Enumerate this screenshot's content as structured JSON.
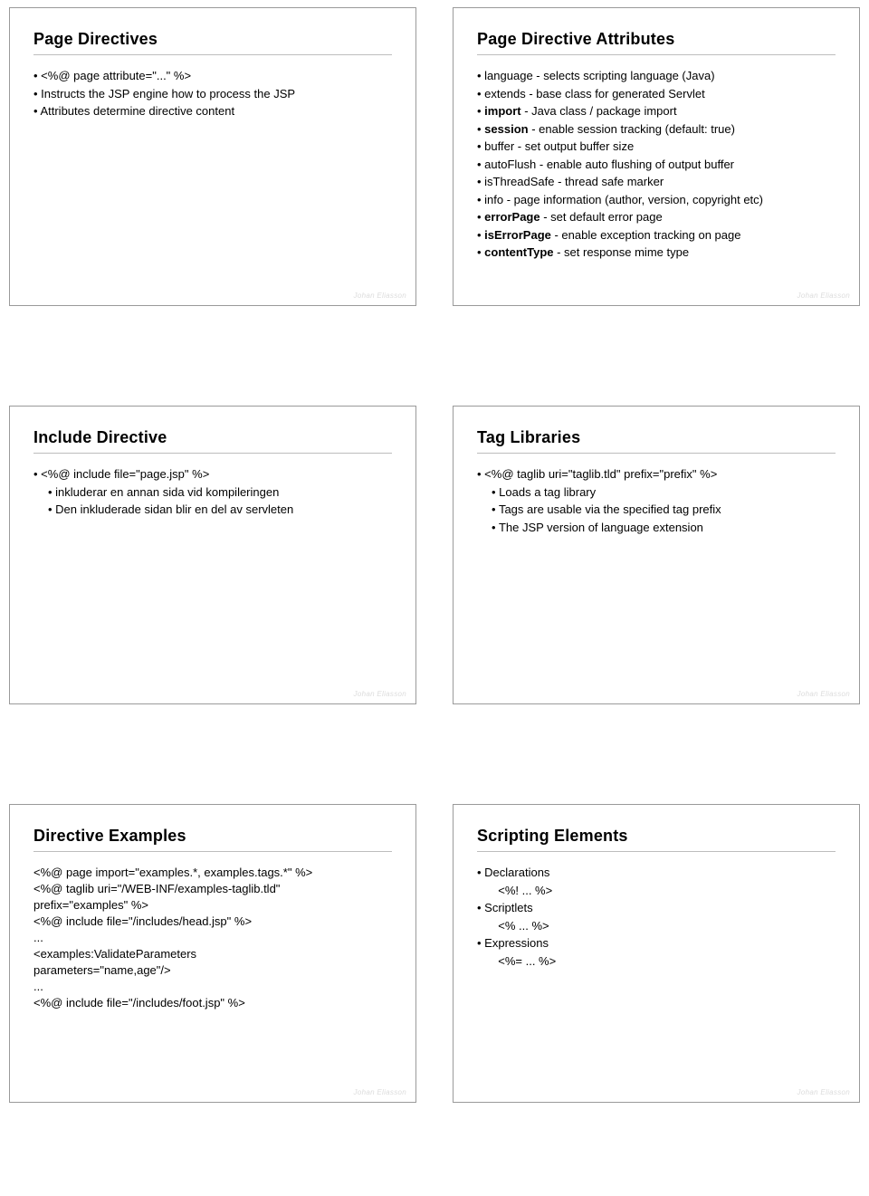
{
  "author_mark": "Johan Eliasson",
  "slides": [
    {
      "title": "Page Directives",
      "lines": [
        {
          "html": "<%@ page attribute=\"...\" %>"
        },
        {
          "html": "Instructs the JSP engine how to process the JSP"
        },
        {
          "html": "Attributes determine directive content"
        }
      ]
    },
    {
      "title": "Page Directive Attributes",
      "lines": [
        {
          "html": "language - selects scripting language (Java)"
        },
        {
          "html": "extends - base class for generated Servlet"
        },
        {
          "html": "<b>import</b> - Java class / package import"
        },
        {
          "html": "<b>session</b> - enable session tracking (default: true)"
        },
        {
          "html": "buffer - set output buffer size"
        },
        {
          "html": "autoFlush - enable auto flushing of output buffer"
        },
        {
          "html": "isThreadSafe - thread safe marker"
        },
        {
          "html": "info - page information (author, version, copyright etc)"
        },
        {
          "html": "<b>errorPage</b> - set default error page"
        },
        {
          "html": "<b>isErrorPage</b> - enable exception tracking on page"
        },
        {
          "html": "<b>contentType</b> - set response mime type"
        }
      ]
    },
    {
      "title": "Include Directive",
      "top_line": "<%@ include file=\"page.jsp\" %>",
      "sub_lines": [
        "inkluderar en annan  sida vid kompileringen",
        "Den inkluderade sidan blir en del av servleten"
      ]
    },
    {
      "title": "Tag Libraries",
      "top_line": "<%@ taglib uri=\"taglib.tld\" prefix=\"prefix\" %>",
      "sub_lines": [
        "Loads a tag library",
        "Tags are usable via the specified tag prefix",
        "The JSP version of language extension"
      ]
    },
    {
      "title": "Directive Examples",
      "code": "<%@ page import=\"examples.*, examples.tags.*\" %>\n<%@ taglib uri=\"/WEB-INF/examples-taglib.tld\"\nprefix=\"examples\" %>\n<%@ include file=\"/includes/head.jsp\" %>\n...\n<examples:ValidateParameters\nparameters=\"name,age\"/>\n...\n<%@ include file=\"/includes/foot.jsp\" %>"
    },
    {
      "title": "Scripting Elements",
      "items": [
        {
          "label": "Declarations",
          "syntax": "<%! ... %>"
        },
        {
          "label": "Scriptlets",
          "syntax": "<% ... %>"
        },
        {
          "label": "Expressions",
          "syntax": "<%= ... %>"
        }
      ]
    }
  ]
}
